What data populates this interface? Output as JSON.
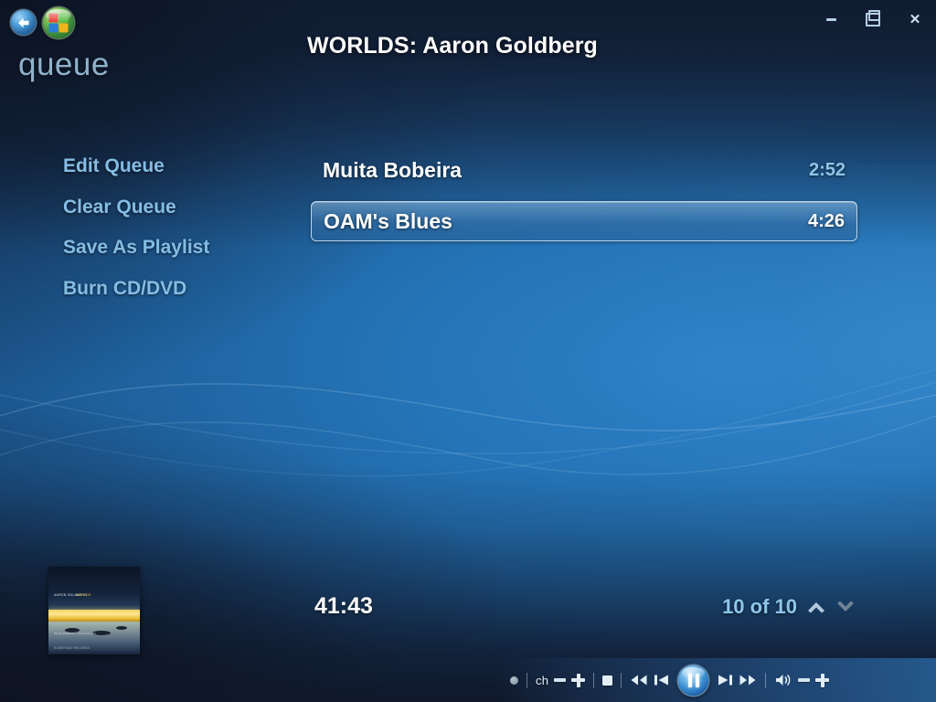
{
  "window": {
    "minimize_label": "Minimize",
    "restore_label": "Restore",
    "close_label": "Close",
    "close_glyph": "✕"
  },
  "header": {
    "back_label": "Back",
    "logo_label": "Windows Media Center Start",
    "section": "queue",
    "title": "WORLDS: Aaron Goldberg"
  },
  "menu": {
    "items": [
      {
        "label": "Edit Queue"
      },
      {
        "label": "Clear Queue"
      },
      {
        "label": "Save As Playlist"
      },
      {
        "label": "Burn CD/DVD"
      }
    ]
  },
  "tracks": {
    "items": [
      {
        "name": "Muita Bobeira",
        "duration": "2:52",
        "selected": false
      },
      {
        "name": "OAM's Blues",
        "duration": "4:26",
        "selected": true
      }
    ]
  },
  "now_playing": {
    "album_art_alt": "Album cover art",
    "album_art_line1": "AARON GOLDBERG",
    "album_art_line2": "WORLDS",
    "album_art_line3": "MUITA BOBEIRA · OAM'S BLUES",
    "album_art_line4": "SUNNYSIDE RECORDS",
    "elapsed": "41:43",
    "pager_text": "10 of 10",
    "page_up_label": "Previous page",
    "page_down_label": "Next page"
  },
  "transport": {
    "record_label": "Record",
    "channel_label": "ch",
    "channel_down_label": "Channel down",
    "channel_up_label": "Channel up",
    "stop_label": "Stop",
    "rewind_label": "Rewind",
    "previous_label": "Previous",
    "pause_label": "Pause",
    "next_label": "Next",
    "fast_forward_label": "Fast forward",
    "mute_label": "Mute",
    "volume_down_label": "Volume down",
    "volume_up_label": "Volume up"
  },
  "colors": {
    "accent_blue": "#85bde4",
    "title_white": "#ffffff",
    "duration_blue": "#8fc6e8",
    "selection_border": "#b9d6ea",
    "background_deep": "#14213a",
    "background_bright": "#2d82c8"
  }
}
